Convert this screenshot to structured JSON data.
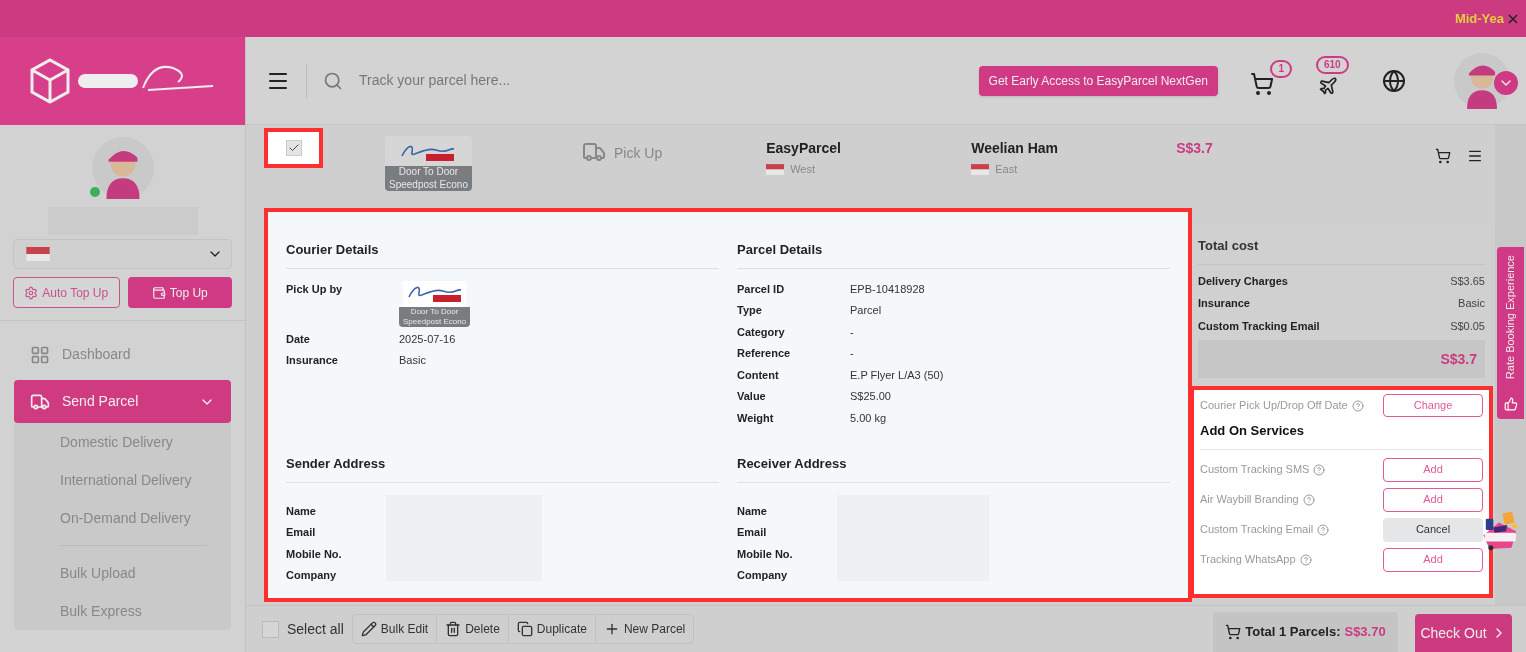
{
  "promo_bar": {
    "text": "Mid-Yea"
  },
  "sidebar": {
    "buttons": [
      {
        "label": "Auto Top Up",
        "kind": "outline"
      },
      {
        "label": "Top Up",
        "kind": "filled"
      }
    ],
    "nav": [
      {
        "label": "Dashboard",
        "selected": false
      },
      {
        "label": "Send Parcel",
        "selected": true,
        "expanded": true,
        "children": [
          {
            "label": "Domestic Delivery"
          },
          {
            "label": "International Delivery"
          },
          {
            "label": "On-Demand Delivery"
          },
          {
            "kind": "divider"
          },
          {
            "label": "Bulk Upload"
          },
          {
            "label": "Bulk Express"
          }
        ]
      }
    ]
  },
  "header": {
    "search": {
      "placeholder": "Track your parcel here..."
    },
    "cta": "Get Early Access to EasyParcel NextGen",
    "cart_count": "1",
    "notification_count": "610"
  },
  "parcel_row": {
    "checked": true,
    "highlighted": true,
    "service": [
      "Door To Door",
      "Speedpost Econo"
    ],
    "method": "Pick Up",
    "sender": {
      "name": "EasyParcel",
      "region": "West"
    },
    "receiver": {
      "name": "Weelian Ham",
      "region": "East"
    },
    "price": "S$3.7"
  },
  "details": {
    "highlighted": true,
    "courier": {
      "title": "Courier Details",
      "pick_up_label": "Pick Up by",
      "service": [
        "Door To Door",
        "Speedpost Econo"
      ],
      "rows": [
        {
          "label": "Date",
          "value": "2025-07-16"
        },
        {
          "label": "Insurance",
          "value": "Basic"
        }
      ]
    },
    "parcel": {
      "title": "Parcel Details",
      "rows": [
        {
          "label": "Parcel ID",
          "value": "EPB-10418928"
        },
        {
          "label": "Type",
          "value": "Parcel"
        },
        {
          "label": "Category",
          "value": "-"
        },
        {
          "label": "Reference",
          "value": "-"
        },
        {
          "label": "Content",
          "value": "E.P Flyer L/A3 (50)"
        },
        {
          "label": "Value",
          "value": "S$25.00"
        },
        {
          "label": "Weight",
          "value": "5.00 kg"
        }
      ]
    },
    "sender": {
      "title": "Sender Address",
      "labels": [
        "Name",
        "Email",
        "Mobile No.",
        "Company"
      ]
    },
    "receiver": {
      "title": "Receiver Address",
      "labels": [
        "Name",
        "Email",
        "Mobile No.",
        "Company"
      ]
    }
  },
  "total_cost": {
    "title": "Total cost",
    "rows": [
      {
        "label": "Delivery Charges",
        "value": "S$3.65"
      },
      {
        "label": "Insurance",
        "value": "Basic"
      },
      {
        "label": "Custom Tracking Email",
        "value": "S$0.05"
      }
    ],
    "total": "S$3.7"
  },
  "add_ons": {
    "highlighted": true,
    "date_label": "Courier Pick Up/Drop Off Date",
    "date_button": "Change",
    "title": "Add On Services",
    "items": [
      {
        "label": "Custom Tracking SMS",
        "action": "Add",
        "added": false
      },
      {
        "label": "Air Waybill Branding",
        "action": "Add",
        "added": false
      },
      {
        "label": "Custom Tracking Email",
        "action": "Cancel",
        "added": true
      },
      {
        "label": "Tracking WhatsApp",
        "action": "Add",
        "added": false
      }
    ]
  },
  "feedback_tab": "Rate Booking Experience",
  "bottom_bar": {
    "select_all": {
      "label": "Select all",
      "checked": false
    },
    "actions": [
      {
        "label": "Bulk Edit"
      },
      {
        "label": "Delete"
      },
      {
        "label": "Duplicate"
      },
      {
        "label": "New Parcel"
      }
    ],
    "total_label": "Total 1 Parcels:",
    "total_value": "S$3.70",
    "checkout": "Check Out"
  }
}
